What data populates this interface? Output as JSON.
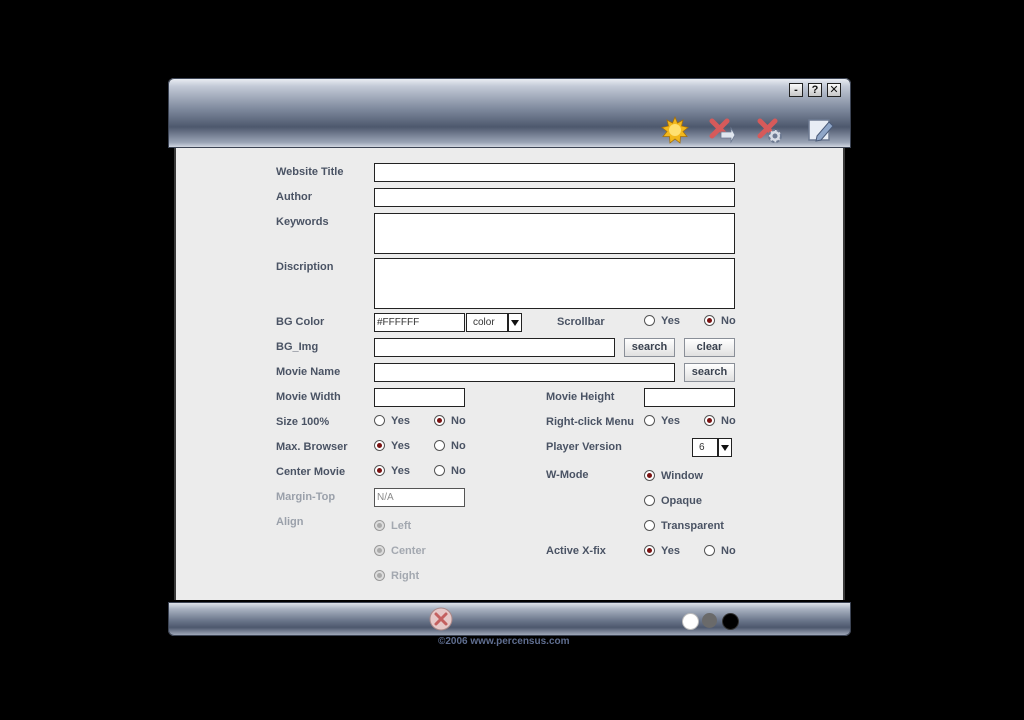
{
  "window": {
    "controls": {
      "minimize": "-",
      "help": "?",
      "close": "✕"
    },
    "toolbar_icons": [
      "sun-icon",
      "cancel-arrow-icon",
      "cancel-gear-icon",
      "edit-icon"
    ]
  },
  "form": {
    "website_title": {
      "label": "Website Title",
      "value": ""
    },
    "author": {
      "label": "Author",
      "value": ""
    },
    "keywords": {
      "label": "Keywords",
      "value": ""
    },
    "description": {
      "label": "Discription",
      "value": ""
    },
    "bg_color": {
      "label": "BG Color",
      "value": "#FFFFFF",
      "picker": "color"
    },
    "scrollbar": {
      "label": "Scrollbar",
      "yes": "Yes",
      "no": "No",
      "selected": "No"
    },
    "bg_img": {
      "label": "BG_Img",
      "value": "",
      "search": "search",
      "clear": "clear"
    },
    "movie_name": {
      "label": "Movie Name",
      "value": "",
      "search": "search"
    },
    "movie_width": {
      "label": "Movie Width",
      "value": ""
    },
    "movie_height": {
      "label": "Movie Height",
      "value": ""
    },
    "size_100": {
      "label": "Size 100%",
      "yes": "Yes",
      "no": "No",
      "selected": "No"
    },
    "right_click": {
      "label": "Right-click Menu",
      "yes": "Yes",
      "no": "No",
      "selected": "No"
    },
    "max_browser": {
      "label": "Max. Browser",
      "yes": "Yes",
      "no": "No",
      "selected": "Yes"
    },
    "player_version": {
      "label": "Player Version",
      "value": "6"
    },
    "center_movie": {
      "label": "Center Movie",
      "yes": "Yes",
      "no": "No",
      "selected": "Yes"
    },
    "wmode": {
      "label": "W-Mode",
      "options": [
        "Window",
        "Opaque",
        "Transparent"
      ],
      "selected": "Window"
    },
    "margin_top": {
      "label": "Margin-Top",
      "value": "N/A"
    },
    "align": {
      "label": "Align",
      "options": [
        "Left",
        "Center",
        "Right"
      ]
    },
    "active_xfix": {
      "label": "Active X-fix",
      "yes": "Yes",
      "no": "No",
      "selected": "Yes"
    }
  },
  "footer": {
    "copyright": "©2006 www.percensus.com",
    "theme_colors": [
      "#ffffff",
      "#6a6a6a",
      "#000000"
    ]
  }
}
